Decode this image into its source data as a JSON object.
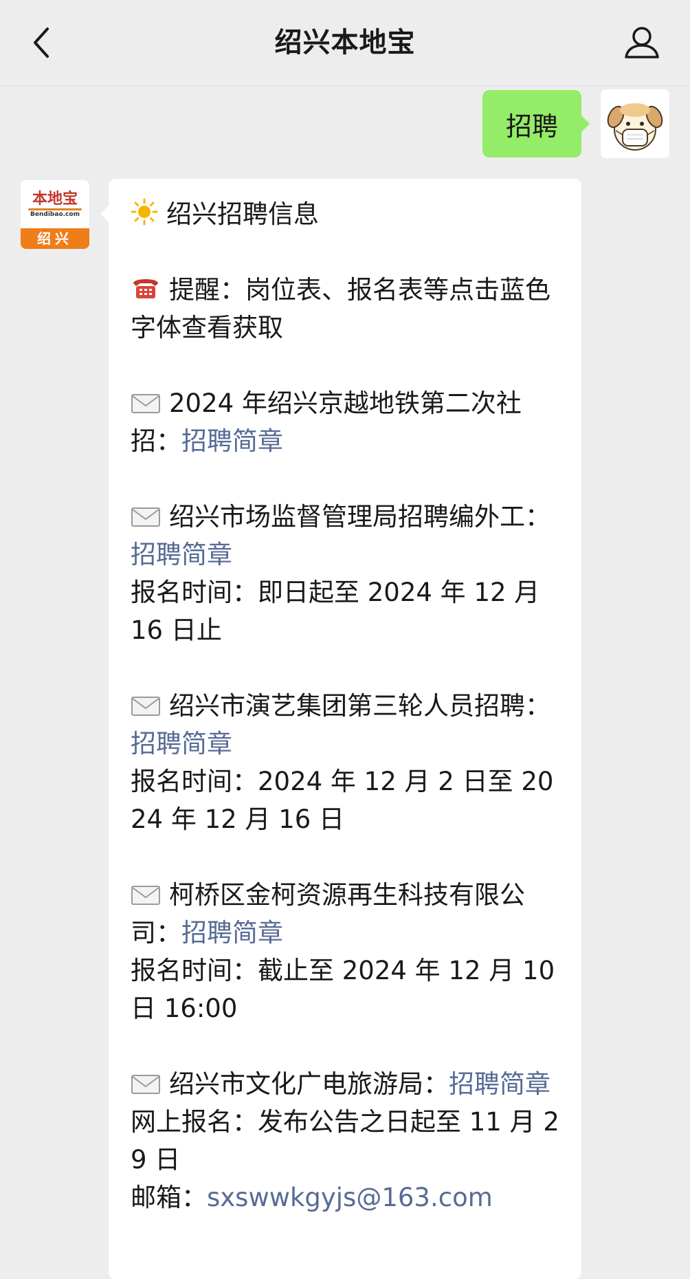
{
  "header": {
    "title": "绍兴本地宝"
  },
  "icons": {
    "back": "back-chevron-icon",
    "profile": "person-icon"
  },
  "outgoing": {
    "text": "招聘"
  },
  "bot_avatar": {
    "logo_cn": "本地宝",
    "logo_en": "Bendibao.com",
    "city": "绍兴"
  },
  "message": {
    "heading": "绍兴招聘信息",
    "reminder": "提醒：岗位表、报名表等点击蓝色字体查看获取",
    "items": [
      {
        "title": "2024 年绍兴京越地铁第二次社招：",
        "link": "招聘简章"
      },
      {
        "title": "绍兴市场监督管理局招聘编外工：",
        "link": "招聘简章",
        "detail": "报名时间：即日起至 2024 年 12 月 16 日止"
      },
      {
        "title": "绍兴市演艺集团第三轮人员招聘：",
        "link": "招聘简章",
        "detail": "报名时间：2024 年 12 月 2 日至 2024 年 12 月 16 日"
      },
      {
        "title": "柯桥区金柯资源再生科技有限公司：",
        "link": "招聘简章",
        "detail": "报名时间：截止至 2024 年 12 月 10 日 16:00"
      },
      {
        "title": "绍兴市文化广电旅游局：",
        "link": "招聘简章",
        "detail": "网上报名：发布公告之日起至 11 月 29 日",
        "email_label": "邮箱：",
        "email": "sxswwkgyjs@163.com"
      }
    ]
  },
  "colors": {
    "background": "#ededed",
    "bubble_out": "#95ec69",
    "bubble_in": "#ffffff",
    "link": "#576b95",
    "logo_orange": "#ef7d1a"
  }
}
